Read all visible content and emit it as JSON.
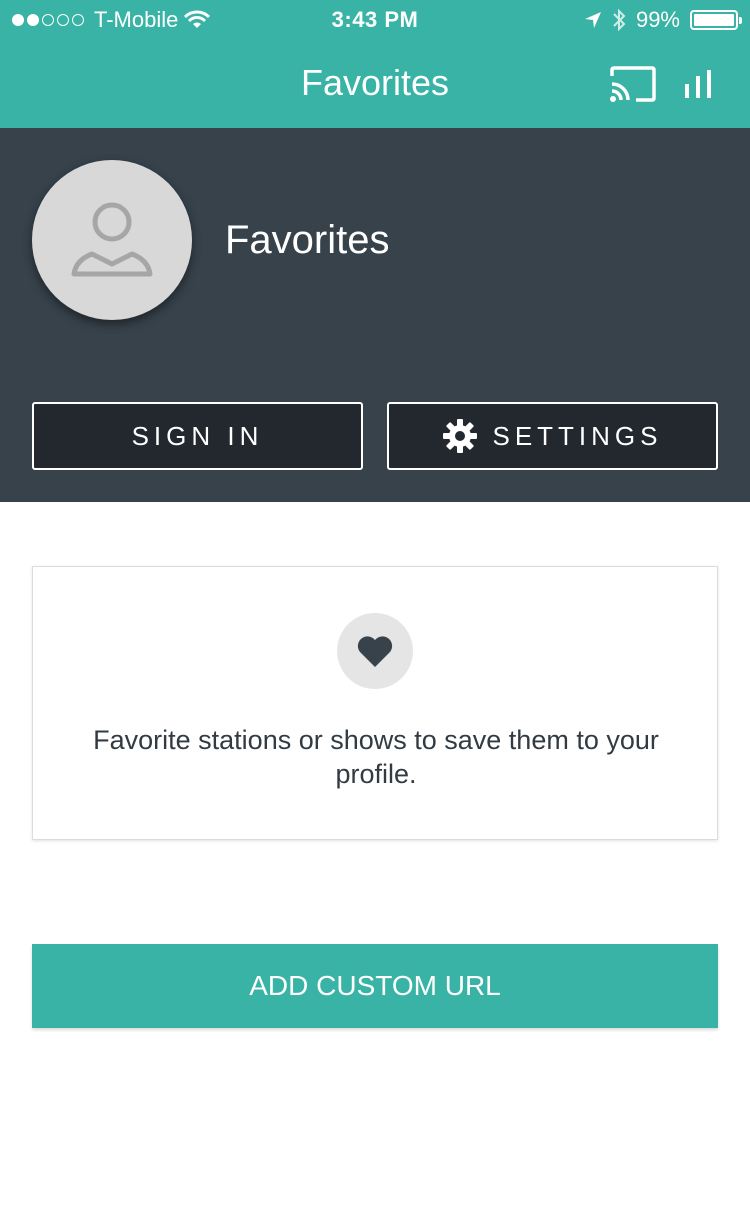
{
  "status_bar": {
    "carrier": "T-Mobile",
    "time": "3:43 PM",
    "battery": "99%",
    "signal_bars_filled": 2,
    "signal_bars_total": 5
  },
  "nav": {
    "title": "Favorites",
    "icons": [
      "cast-icon",
      "equalizer-bars-icon"
    ]
  },
  "profile": {
    "name": "Favorites",
    "avatar_icon": "user-placeholder-icon",
    "sign_in_label": "SIGN IN",
    "settings_label": "SETTINGS",
    "settings_icon": "gear-icon"
  },
  "empty_state": {
    "icon": "heart-icon",
    "message": "Favorite stations or shows to save them to your profile."
  },
  "add_custom_url_label": "ADD CUSTOM URL",
  "colors": {
    "accent": "#38b3a5",
    "header_bg": "#37424b",
    "button_bg": "#22282e"
  }
}
